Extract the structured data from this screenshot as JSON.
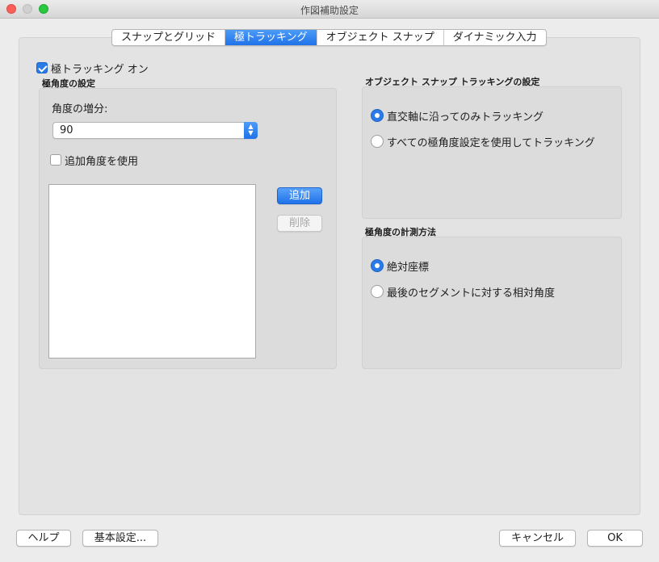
{
  "window": {
    "title": "作図補助設定"
  },
  "tabs": [
    {
      "label": "スナップとグリッド",
      "active": false
    },
    {
      "label": "極トラッキング",
      "active": true
    },
    {
      "label": "オブジェクト スナップ",
      "active": false
    },
    {
      "label": "ダイナミック入力",
      "active": false
    }
  ],
  "polar": {
    "toggle_label": "極トラッキング オン",
    "toggle_checked": true,
    "settings_title": "極角度の設定",
    "increment_label": "角度の増分:",
    "increment_value": "90",
    "additional_label": "追加角度を使用",
    "additional_checked": false,
    "add_button": "追加",
    "delete_button": "削除"
  },
  "osnap_tracking": {
    "title": "オブジェクト スナップ トラッキングの設定",
    "options": [
      {
        "label": "直交軸に沿ってのみトラッキング",
        "selected": true
      },
      {
        "label": "すべての極角度設定を使用してトラッキング",
        "selected": false
      }
    ]
  },
  "measure": {
    "title": "極角度の計測方法",
    "options": [
      {
        "label": "絶対座標",
        "selected": true
      },
      {
        "label": "最後のセグメントに対する相対角度",
        "selected": false
      }
    ]
  },
  "footer": {
    "help": "ヘルプ",
    "preferences": "基本設定...",
    "cancel": "キャンセル",
    "ok": "OK"
  },
  "colors": {
    "accent": "#1f72e8",
    "window_bg": "#ececec"
  }
}
